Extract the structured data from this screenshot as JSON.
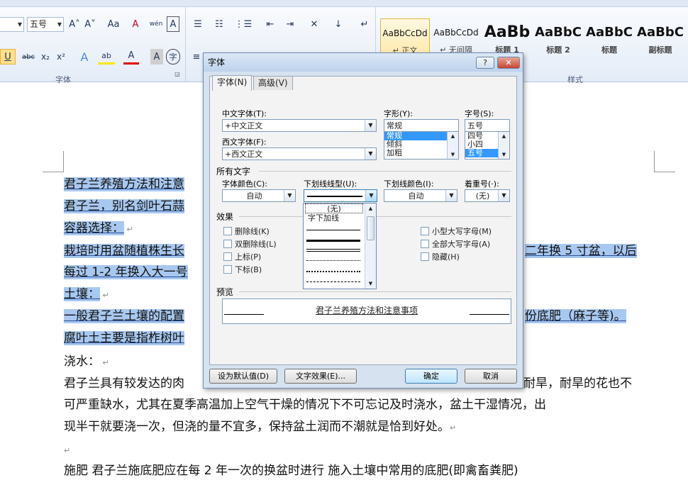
{
  "ribbon": {
    "font_size_value": "五号",
    "grow_font": "A˄",
    "shrink_font": "A˅",
    "change_case": "Aa",
    "clear_format": "A",
    "phonetic": "wén",
    "char_border": "A",
    "underline": "U",
    "strikethrough": "abc",
    "subscript": "x₂",
    "superscript": "x²",
    "text_effect": "A",
    "highlight": "ab",
    "font_color": "A",
    "char_shading": "A",
    "enclose_char": "字",
    "font_group_label": "字体",
    "styles_group_label": "样式",
    "styles": [
      {
        "preview": "AaBbCcDd",
        "name": "↵ 正文"
      },
      {
        "preview": "AaBbCcDd",
        "name": "↵ 无间隔"
      },
      {
        "preview": "AaBb",
        "name": "标题 1"
      },
      {
        "preview": "AaBbC",
        "name": "标题 2"
      },
      {
        "preview": "AaBbC",
        "name": "标题"
      },
      {
        "preview": "AaBbC",
        "name": "副标题"
      }
    ]
  },
  "document": {
    "lines": [
      {
        "text": "君子兰养殖方法和注意",
        "hl": true
      },
      {
        "text": "君子兰，别名剑叶石蒜",
        "hl": true
      },
      {
        "text": "容器选择：",
        "hl": true
      },
      {
        "text": "栽培时用盆随植株生长",
        "hl": true
      },
      {
        "text": "每过 1-2 年换入大一号",
        "hl": true
      },
      {
        "text": "土壤：",
        "hl": true
      },
      {
        "text": "一般君子兰土壤的配置",
        "hl": true
      },
      {
        "text": "腐叶土主要是指柞树叶",
        "hl": true
      },
      {
        "text": "浇水：",
        "hl": false
      },
      {
        "text": "君子兰具有较发达的肉",
        "hl": false
      },
      {
        "text": "可严重缺水，尤其在夏季高温加上空气干燥的情况下不可忘记及时浇水，盆土干湿情况，出",
        "hl": false
      },
      {
        "text": "现半干就要浇一次，但浇的量不宜多，保持盆土润而不潮就是恰到好处。",
        "hl": false
      },
      {
        "text": "",
        "hl": false
      },
      {
        "text": "施肥  君子兰施底肥应在每 2 年一次的换盆时进行  施入土壤中常用的底肥(即禽畜粪肥)",
        "hl": false
      }
    ],
    "right_fragments": [
      "二年换 5 寸盆，以后",
      "份底肥（麻子等)。",
      "耐旱，耐旱的花也不"
    ]
  },
  "dialog": {
    "title": "字体",
    "help": "?",
    "close": "✕",
    "tabs": [
      "字体(N)",
      "高级(V)"
    ],
    "chinese_font_label": "中文字体(T):",
    "chinese_font_value": "+中文正文",
    "western_font_label": "西文字体(F):",
    "western_font_value": "+西文正文",
    "style_label": "字形(Y):",
    "style_value": "常规",
    "style_options": [
      "常规",
      "倾斜",
      "加粗"
    ],
    "size_label": "字号(S):",
    "size_value": "五号",
    "size_options": [
      "四号",
      "小四",
      "五号"
    ],
    "all_text_label": "所有文字",
    "font_color_label": "字体颜色(C):",
    "font_color_value": "自动",
    "underline_type_label": "下划线线型(U):",
    "underline_color_label": "下划线颜色(I):",
    "underline_color_value": "自动",
    "emphasis_label": "着重号(·):",
    "emphasis_value": "(无)",
    "effects_label": "效果",
    "effects_left": [
      "删除线(K)",
      "双删除线(L)",
      "上标(P)",
      "下标(B)"
    ],
    "effects_right": [
      "小型大写字母(M)",
      "全部大写字母(A)",
      "隐藏(H)"
    ],
    "preview_label": "预览",
    "preview_text": "君子兰养殖方法和注意事项",
    "btn_default": "设为默认值(D)",
    "btn_effects": "文字效果(E)...",
    "btn_ok": "确定",
    "btn_cancel": "取消",
    "underline_popup": {
      "items": [
        "(无)",
        "字下加线"
      ]
    }
  }
}
